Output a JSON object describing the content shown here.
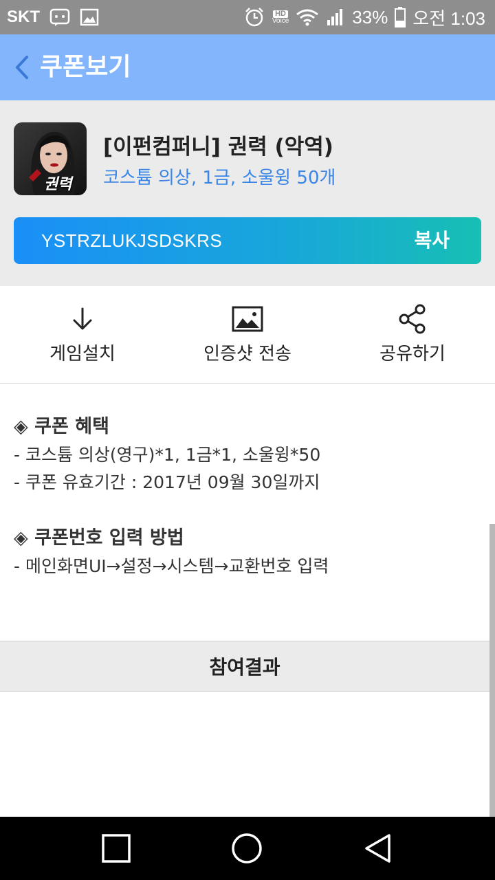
{
  "status_bar": {
    "carrier": "SKT",
    "hd_label": "HD",
    "voice_label": "Voice",
    "battery": "33%",
    "time": "오전 1:03",
    "icons": [
      "message-icon",
      "image-icon",
      "alarm-icon",
      "hd-voice-icon",
      "wifi-icon",
      "signal-icon",
      "battery-icon"
    ]
  },
  "header": {
    "title": "쿠폰보기",
    "color": "#82b5fb"
  },
  "coupon": {
    "title": "[이펀컴퍼니] 권력 (악역)",
    "reward": "코스튬 의상, 1금, 소울윙 50개",
    "thumb_text": "권력",
    "code": "YSTRZLUKJSDSKRS",
    "copy_label": "복사",
    "accent_color": "#3a86e6"
  },
  "actions": [
    {
      "label": "게임설치",
      "icon": "download-icon"
    },
    {
      "label": "인증샷 전송",
      "icon": "image-icon"
    },
    {
      "label": "공유하기",
      "icon": "share-icon"
    }
  ],
  "info": {
    "benefit_title": "◈ 쿠폰 혜택",
    "benefit_lines": [
      "- 코스튬 의상(영구)*1, 1금*1, 소울윙*50",
      "- 쿠폰 유효기간 : 2017년 09월 30일까지"
    ],
    "method_title": "◈ 쿠폰번호 입력 방법",
    "method_lines": [
      "- 메인화면UI→설정→시스템→교환번호 입력"
    ]
  },
  "results": {
    "label": "참여결과"
  },
  "nav_bar": {
    "buttons": [
      "recent-apps-icon",
      "home-icon",
      "back-icon"
    ]
  }
}
